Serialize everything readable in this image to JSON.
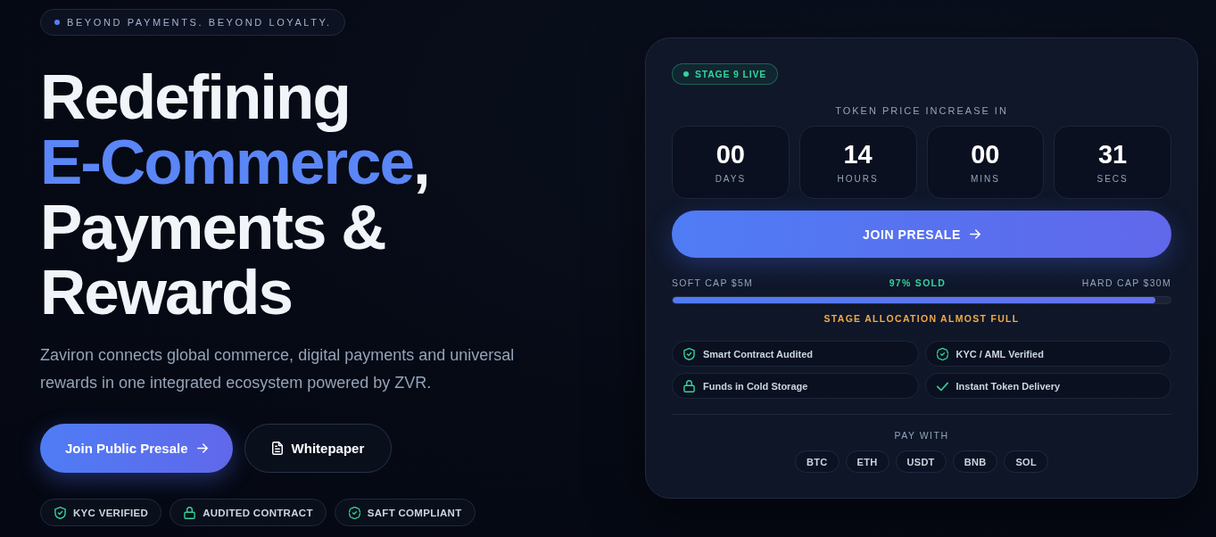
{
  "tagline": {
    "text": "BEYOND PAYMENTS. BEYOND LOYALTY."
  },
  "headline": {
    "lines": [
      [
        {
          "text": "Redefining",
          "accent": false
        }
      ],
      [
        {
          "text": "E-Commerce",
          "accent": true
        },
        {
          "text": ",",
          "accent": false
        }
      ],
      [
        {
          "text": "Payments &",
          "accent": false
        }
      ],
      [
        {
          "text": "Rewards",
          "accent": false
        }
      ]
    ]
  },
  "description": "Zaviron connects global commerce, digital payments and universal rewards in one integrated ecosystem powered by ZVR.",
  "actions": [
    {
      "label": "Join Public Presale",
      "kind": "primary"
    },
    {
      "label": "Whitepaper",
      "kind": "secondary"
    }
  ],
  "trust_badges": [
    "KYC VERIFIED",
    "AUDITED CONTRACT",
    "SAFT COMPLIANT"
  ],
  "presale": {
    "stage": "STAGE 9 LIVE",
    "countdown": {
      "title": "TOKEN PRICE INCREASE IN",
      "units": [
        {
          "value": "00",
          "label": "DAYS"
        },
        {
          "value": "14",
          "label": "HOURS"
        },
        {
          "value": "00",
          "label": "MINS"
        },
        {
          "value": "31",
          "label": "SECS"
        }
      ]
    },
    "join_button": "JOIN PRESALE",
    "progress": {
      "soft_cap": "SOFT CAP $5M",
      "sold": "97% SOLD",
      "hard_cap": "HARD CAP $30M",
      "level": 0.97,
      "note": "STAGE ALLOCATION ALMOST FULL"
    },
    "features": [
      "Smart Contract Audited",
      "KYC / AML Verified",
      "Funds in Cold Storage",
      "Instant Token Delivery"
    ],
    "payment": {
      "title": "PAY WITH",
      "currencies": [
        "BTC",
        "ETH",
        "USDT",
        "BNB",
        "SOL"
      ]
    }
  }
}
